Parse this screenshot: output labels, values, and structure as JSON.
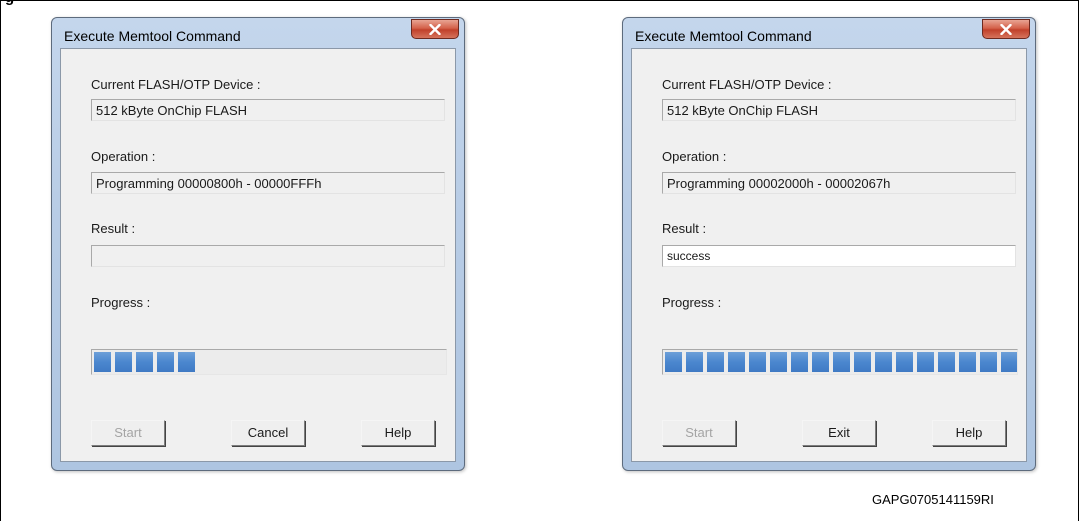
{
  "figure": {
    "heading_fragment": "g",
    "code": "GAPG0705141159RI"
  },
  "left_dialog": {
    "title": "Execute Memtool Command",
    "device_label": "Current FLASH/OTP Device :",
    "device_value": "512 kByte OnChip FLASH",
    "operation_label": "Operation :",
    "operation_value": "Programming 00000800h - 00000FFFh",
    "result_label": "Result :",
    "result_value": "",
    "progress_label": "Progress :",
    "progress_segments_filled": 5,
    "progress_fraction": 0.28,
    "buttons": {
      "start": "Start",
      "second": "Cancel",
      "help": "Help"
    }
  },
  "right_dialog": {
    "title": "Execute Memtool Command",
    "device_label": "Current FLASH/OTP Device :",
    "device_value": "512 kByte OnChip FLASH",
    "operation_label": "Operation :",
    "operation_value": "Programming 00002000h - 00002067h",
    "result_label": "Result :",
    "result_value": "success",
    "progress_label": "Progress :",
    "progress_segments_filled": 17,
    "progress_fraction": 1.0,
    "buttons": {
      "start": "Start",
      "second": "Exit",
      "help": "Help"
    }
  },
  "colors": {
    "progress_fill": "#4b87cf",
    "close_button": "#c1412b",
    "title_bar": "#b9cde6"
  },
  "icons": {
    "close": "close-x-icon"
  }
}
